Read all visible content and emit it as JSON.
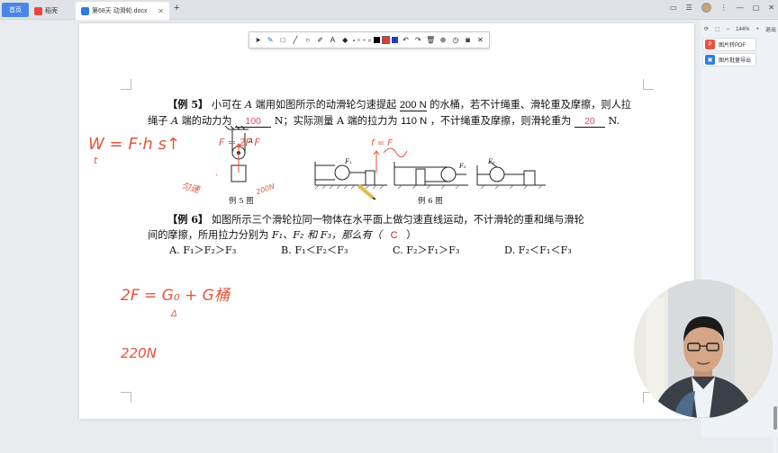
{
  "tabs": {
    "home": "首页",
    "daoke": "稻壳",
    "document": "第68天 动滑轮.docx",
    "add": "+"
  },
  "toolbar": {
    "tools": [
      "cursor-icon",
      "pen-icon",
      "rectangle-icon",
      "line-icon",
      "circle-icon",
      "marker-icon",
      "text-icon",
      "eraser-icon"
    ],
    "colors": [
      "#000000",
      "#e53935",
      "#1e3fbf"
    ],
    "actions": [
      "undo-icon",
      "redo-icon",
      "delete-icon",
      "zoom-icon",
      "timer-icon",
      "camera-icon",
      "close-icon"
    ]
  },
  "right_panel": {
    "zoom": "144%",
    "exit": "退出",
    "btn_pdf": "图片转PDF",
    "btn_export": "图片批量导出",
    "colors": {
      "pdf": "#e8553f",
      "export": "#2f7be5"
    }
  },
  "doc": {
    "ex5_label": "【例 5】",
    "ex5_line1_a": "小可在",
    "ex5_A": "A",
    "ex5_line1_b": "端用如图所示的动滑轮匀速提起",
    "ex5_val1": "200 N",
    "ex5_line1_c": "的水桶，若不计绳重、滑轮重及摩擦，则人拉",
    "ex5_line2_a": "绳子",
    "ex5_line2_b": "端的动力为",
    "ex5_ans1": "100",
    "ex5_line2_c": "N；实际测量",
    "ex5_line2_d": "A 端的拉力为",
    "ex5_val2": "110 N",
    "ex5_line2_e": "，不计绳重及摩擦，则滑轮重为",
    "ex5_ans2": "20",
    "ex5_line2_f": "N.",
    "fig5_caption": "例 5 图",
    "fig6_caption": "例 6 图",
    "ex6_label": "【例 6】",
    "ex6_line1": "如图所示三个滑轮拉同一物体在水平面上做匀速直线运动，不计滑轮的重和绳与滑轮",
    "ex6_line2_a": "间的摩擦，所用拉力分别为",
    "ex6_line2_b": "F₁、F₂ 和 F₃，那么有（",
    "ex6_ans": "C",
    "ex6_line2_c": "）",
    "options": {
      "a": "A. F₁＞F₂＞F₃",
      "b": "B. F₁＜F₂＜F₃",
      "c": "C. F₂＞F₁＞F₃",
      "d": "D. F₂＜F₁＜F₃"
    },
    "fig_labels": {
      "A": "A",
      "F": "F",
      "F1": "F₁",
      "F2": "F₂",
      "F3": "F₃"
    }
  },
  "handwriting": {
    "w_formula": "W = F·h s↑",
    "w_denom": "t",
    "mid_notes": "F = 2F  F",
    "slope_note": "匀速",
    "small_note": "200N",
    "friction_note": "f = F",
    "eq1": "2F = G₀ + G桶",
    "eq1_denom": "Δ",
    "val": "220N"
  }
}
